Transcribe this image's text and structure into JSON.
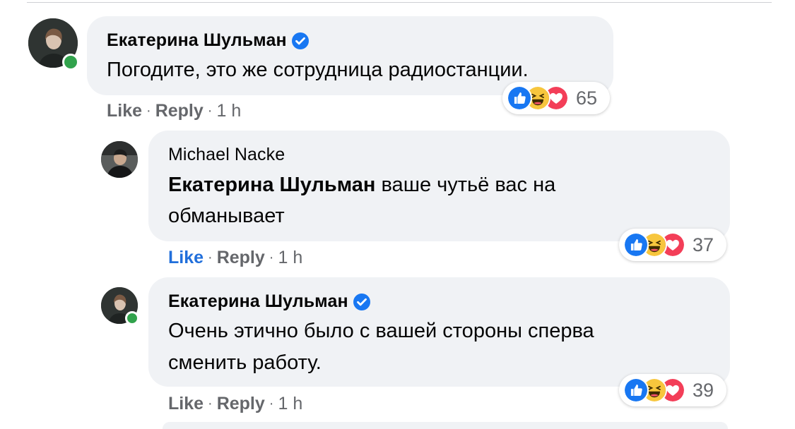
{
  "comments": [
    {
      "author": "Екатерина Шульман",
      "text": "Погодите, это же сотрудница радиостанции.",
      "reactions_count": "65",
      "like": "Like",
      "reply": "Reply",
      "time": "1 h"
    },
    {
      "author": "Michael Nacke",
      "mention": "Екатерина Шульман",
      "text_line1": " ваше чутьё вас на",
      "text_line2": "обманывает",
      "reactions_count": "37",
      "like": "Like",
      "reply": "Reply",
      "time": "1 h"
    },
    {
      "author": "Екатерина Шульман",
      "text_line1": "Очень этично было с вашей стороны сперва",
      "text_line2": "сменить работу.",
      "reactions_count": "39",
      "like": "Like",
      "reply": "Reply",
      "time": "1 h"
    }
  ],
  "reaction_icons": [
    "like-icon",
    "haha-icon",
    "love-icon"
  ],
  "separator": "·",
  "colors": {
    "bubble": "#f0f2f5",
    "link_liked": "#216fdb",
    "meta": "#65676b",
    "verified": "#1877f2",
    "online": "#31a24c"
  }
}
